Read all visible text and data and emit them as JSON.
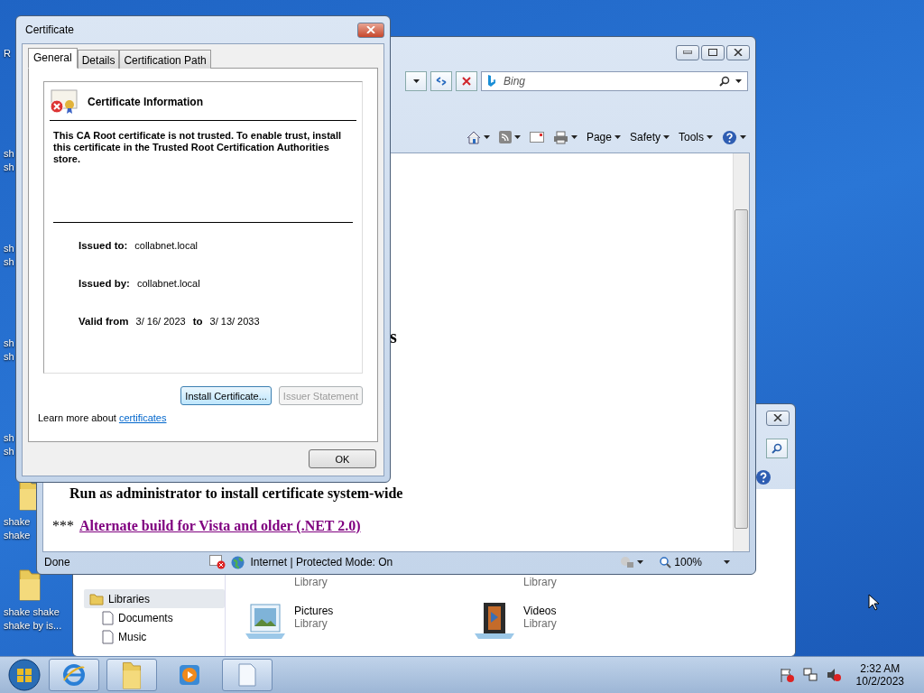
{
  "desktop": {
    "icons": [
      {
        "kind": "partial",
        "lines": [
          "R"
        ]
      },
      {
        "kind": "partial",
        "lines": [
          "sh",
          "sh"
        ]
      },
      {
        "kind": "partial",
        "lines": [
          "sh",
          "sh"
        ]
      },
      {
        "kind": "partial",
        "lines": [
          "sh",
          "sh"
        ]
      },
      {
        "kind": "partial",
        "lines": [
          "sh",
          "sh"
        ]
      },
      {
        "kind": "folder",
        "lines": [
          "shake",
          "shake"
        ]
      },
      {
        "kind": "folder",
        "lines": [
          "shake shake",
          "shake by is..."
        ]
      }
    ]
  },
  "explorer": {
    "nav": [
      {
        "label": "Libraries",
        "selected": true,
        "children": [
          {
            "label": "Documents",
            "selected": false
          },
          {
            "label": "Music",
            "selected": false
          }
        ]
      }
    ],
    "libraries": [
      {
        "kind": "documents",
        "sub": "Library"
      },
      {
        "kind": "music",
        "sub": "Library"
      },
      {
        "kind": "pictures",
        "name": "Pictures",
        "sub": "Library"
      },
      {
        "kind": "videos",
        "name": "Videos",
        "sub": "Library"
      }
    ]
  },
  "browser": {
    "search": {
      "placeholder": "Bing"
    },
    "commands": [
      {
        "label": "Page"
      },
      {
        "label": "Safety"
      },
      {
        "label": "Tools"
      }
    ],
    "page": {
      "heading_fragment": "s",
      "note": "Run as administrator to install certificate system-wide",
      "prefix": "***",
      "link": "Alternate build for Vista and older (.NET 2.0)"
    },
    "status": {
      "text": "Done",
      "zone": "Internet | Protected Mode: On",
      "zoom": "100%"
    }
  },
  "certificate_dialog": {
    "title": "Certificate",
    "tabs": [
      {
        "label": "General",
        "selected": true
      },
      {
        "label": "Details",
        "selected": false
      },
      {
        "label": "Certification Path",
        "selected": false
      }
    ],
    "heading": "Certificate Information",
    "message": "This CA Root certificate is not trusted. To enable trust, install this certificate in the Trusted Root Certification Authorities store.",
    "fields": [
      {
        "label": "Issued to:",
        "value": "collabnet.local"
      },
      {
        "label": "Issued by:",
        "value": "collabnet.local"
      }
    ],
    "validity": {
      "label": "Valid from",
      "from": "3/ 16/ 2023",
      "to_label": "to",
      "to": "3/ 13/ 2033"
    },
    "buttons": [
      {
        "label": "Install Certificate...",
        "disabled": false
      },
      {
        "label": "Issuer Statement",
        "disabled": true
      }
    ],
    "learn_more": {
      "text": "Learn more about",
      "link": "certificates"
    },
    "ok": "OK"
  },
  "taskbar": {
    "time": "2:32 AM",
    "date": "10/2/2023"
  }
}
